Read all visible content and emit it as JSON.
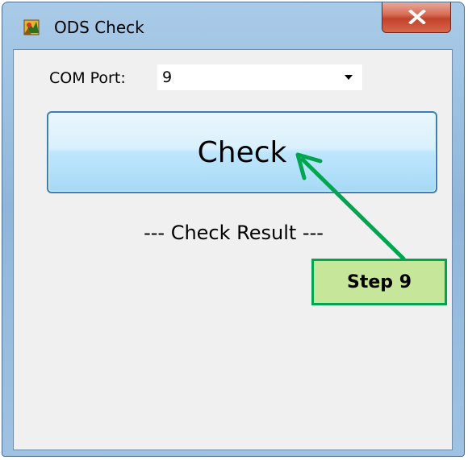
{
  "window": {
    "title": "ODS Check",
    "icon": "app-icon"
  },
  "form": {
    "com_port_label": "COM Port:",
    "com_port_value": "9",
    "check_button_label": "Check",
    "result_text": "--- Check Result ---"
  },
  "annotation": {
    "step_label": "Step 9",
    "color": "#00a550",
    "fill": "#c6e79a"
  }
}
